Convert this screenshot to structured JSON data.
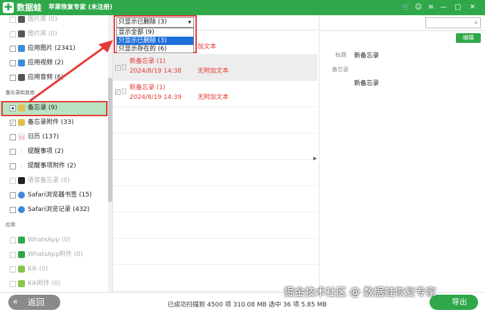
{
  "titlebar": {
    "brand": "数据蛙",
    "title": "苹果恢复专家 (未注册)",
    "controls": [
      "🛒",
      "☺",
      "≡",
      "—",
      "□",
      "✕"
    ]
  },
  "sidebar": {
    "items_top": [
      {
        "label": "图片库 (0)",
        "faded": true,
        "icon_color": "#555"
      },
      {
        "label": "图片库 (0)",
        "faded": true,
        "icon_color": "#555"
      },
      {
        "label": "应用图片 (2341)",
        "faded": false,
        "icon_color": "#3d8bd8"
      },
      {
        "label": "应用视频 (2)",
        "faded": false,
        "icon_color": "#3d8bd8"
      },
      {
        "label": "应用音频 (6)",
        "faded": false,
        "icon_color": "#555"
      }
    ],
    "section1": "备忘录和其他",
    "items_mid": [
      {
        "label": "备忘录 (9)",
        "selected": true,
        "icon_color": "#e0c050"
      },
      {
        "label": "备忘录附件 (33)",
        "checked": true,
        "icon_color": "#e0c050"
      },
      {
        "label": "日历 (137)",
        "icon_color": "#e55"
      },
      {
        "label": "提醒事项 (2)",
        "icon_color": "#aaa"
      },
      {
        "label": "提醒事项附件 (2)",
        "icon_color": "#aaa"
      },
      {
        "label": "语音备忘录 (0)",
        "faded": true,
        "icon_color": "#222"
      },
      {
        "label": "Safari浏览器书签 (15)",
        "icon_color": "#3d8bd8"
      },
      {
        "label": "Safari浏览记录 (432)",
        "icon_color": "#3d8bd8"
      }
    ],
    "section2": "应用",
    "items_apps": [
      {
        "label": "WhatsApp (0)",
        "faded": true,
        "icon_color": "#2fa84a"
      },
      {
        "label": "WhatsApp附件 (0)",
        "faded": true,
        "icon_color": "#2fa84a"
      },
      {
        "label": "Kik (0)",
        "faded": true,
        "icon_color": "#2fa84a"
      },
      {
        "label": "Kik附件 (0)",
        "faded": true,
        "icon_color": "#2fa84a"
      }
    ]
  },
  "filter": {
    "selected": "只显示已删除 (3)",
    "options": [
      "显示全部 (9)",
      "只显示已删除 (3)",
      "只显示存在的 (6)"
    ],
    "highlighted_index": 1
  },
  "notes": [
    {
      "title": "",
      "date": "",
      "status": "加文本",
      "selected": false
    },
    {
      "title": "新备忘录 (1)",
      "date": "2024/8/19 14:38",
      "status": "无附加文本",
      "selected": true
    },
    {
      "title": "新备忘录 (1)",
      "date": "2024/8/19 14:39",
      "status": "无附加文本",
      "selected": false
    }
  ],
  "detail": {
    "edit_label": "编辑",
    "title_label": "标题",
    "title_value": "新备忘录",
    "memo_label": "备忘录",
    "memo_value": "新备忘录"
  },
  "bottom": {
    "back_label": "返回",
    "status": "已成功扫描到 4500 项 310.08 MB  选中 36 项 5.85 MB",
    "export_label": "导出"
  },
  "watermark": "掘金技术社区 @ 数据蛙恢复专家",
  "colors": {
    "accent": "#2fa84a",
    "deleted": "#e53935",
    "highlight": "#1e6fd9",
    "annotation": "#e53935"
  }
}
